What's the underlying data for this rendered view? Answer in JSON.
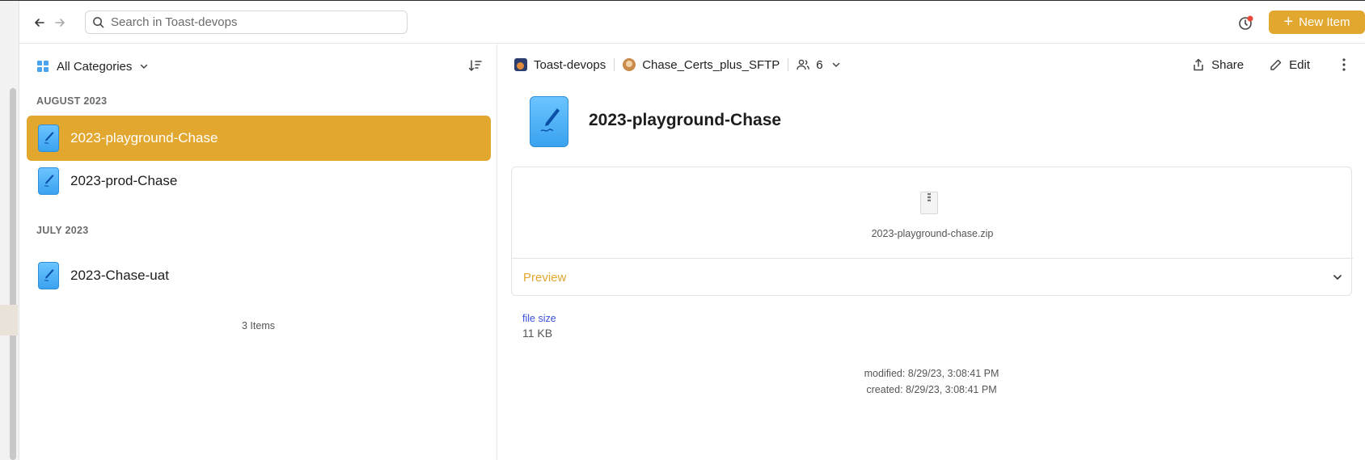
{
  "toolbar": {
    "search_placeholder": "Search in Toast-devops",
    "new_item_label": "New Item"
  },
  "list": {
    "category_filter": "All Categories",
    "sections": [
      {
        "label": "AUGUST 2023",
        "items": [
          "2023-playground-Chase",
          "2023-prod-Chase"
        ]
      },
      {
        "label": "JULY 2023",
        "items": [
          "2023-Chase-uat"
        ]
      }
    ],
    "selected_item": "2023-playground-Chase",
    "count_label": "3 Items"
  },
  "detail": {
    "vault_name": "Toast-devops",
    "shared_with": "Chase_Certs_plus_SFTP",
    "people_count": "6",
    "share_label": "Share",
    "edit_label": "Edit",
    "title": "2023-playground-Chase",
    "file_name": "2023-playground-chase.zip",
    "preview_label": "Preview",
    "file_size_label": "file size",
    "file_size_value": "11 KB",
    "modified": "modified: 8/29/23, 3:08:41 PM",
    "created": "created: 8/29/23, 3:08:41 PM"
  },
  "colors": {
    "accent": "#e2a72e",
    "link_blue": "#3b4fd9",
    "item_icon_blue": "#4aa3f0"
  }
}
